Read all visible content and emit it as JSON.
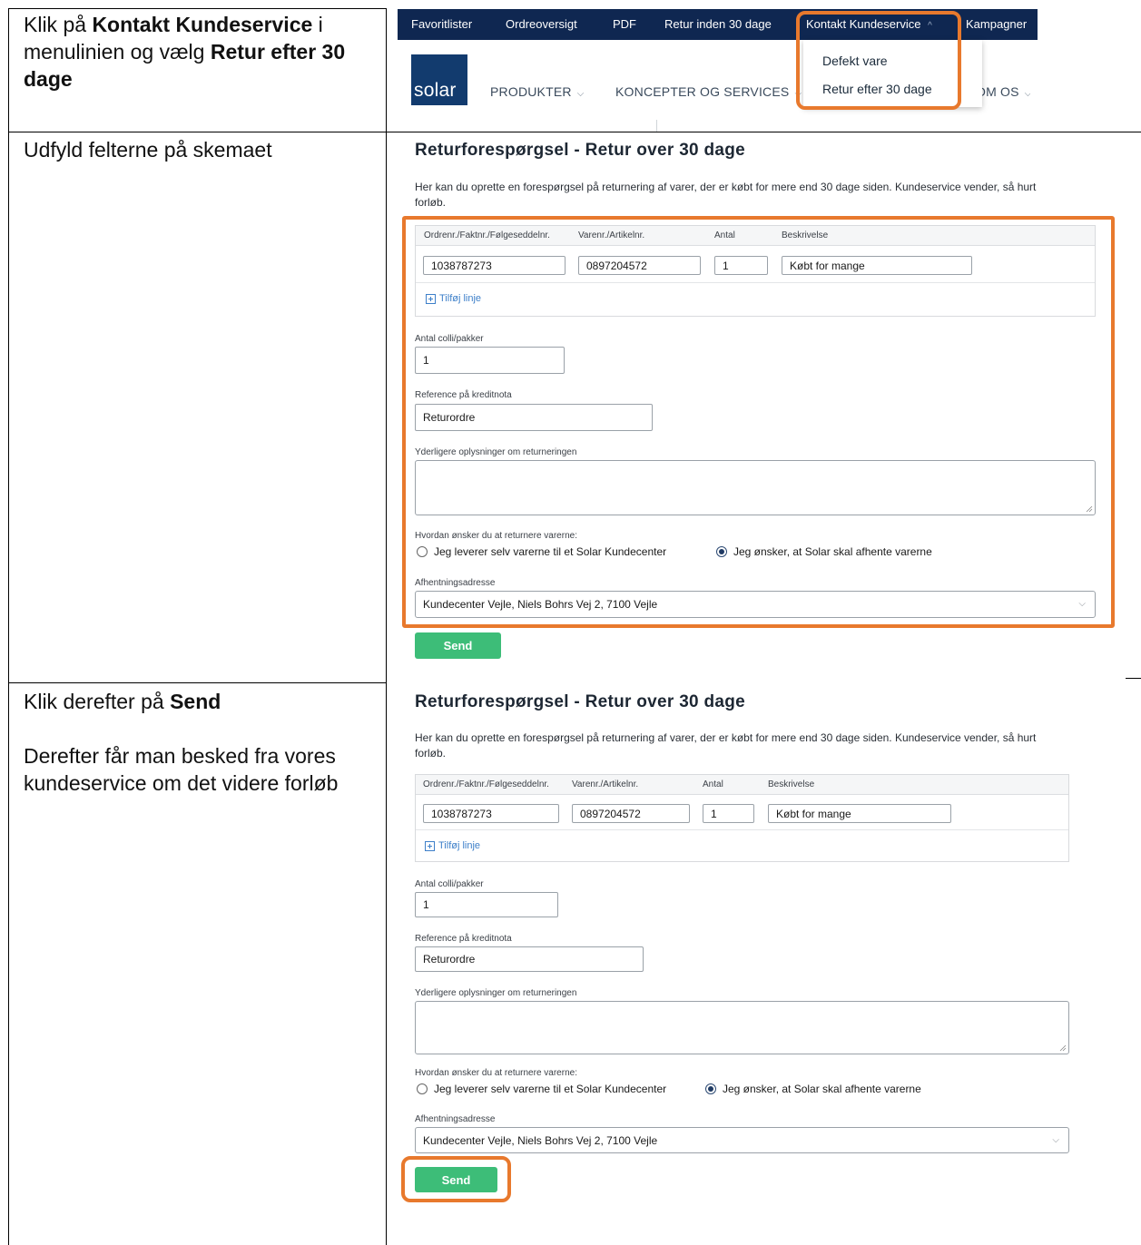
{
  "steps": [
    {
      "text_parts": [
        {
          "t": "Klik på ",
          "b": false
        },
        {
          "t": "Kontakt Kundeservice",
          "b": true
        },
        {
          "t": " i menulinien og vælg ",
          "b": false
        },
        {
          "t": "Retur efter 30 dage",
          "b": true
        }
      ]
    },
    {
      "text": "Udfyld felterne på skemaet"
    },
    {
      "text_parts": [
        {
          "t": "Klik derefter på ",
          "b": false
        },
        {
          "t": "Send",
          "b": true
        }
      ],
      "note": "Derefter får man besked fra vores kundeservice om det videre forløb"
    }
  ],
  "nav": {
    "top_items": [
      "Favoritlister",
      "Ordreoversigt",
      "PDF",
      "Retur inden 30 dage",
      "Kontakt Kundeservice",
      "Kampagner"
    ],
    "active_chevron": "^",
    "logo_text": "solar",
    "secondary_items": [
      "PRODUKTER",
      "KONCEPTER OG SERVICES",
      "OM OS"
    ],
    "dropdown_items": [
      "Defekt vare",
      "Retur efter 30 dage"
    ]
  },
  "form": {
    "title": "Returforespørgsel - Retur over 30 dage",
    "intro_line1": "Her kan du oprette en forespørgsel på returnering af varer, der er købt for mere end 30 dage siden. Kundeservice vender, så hurt",
    "intro_line2": "forløb.",
    "columns": [
      "Ordrenr./Faktnr./Følgeseddelnr.",
      "Varenr./Artikelnr.",
      "Antal",
      "Beskrivelse"
    ],
    "row": {
      "order": "1038787273",
      "item": "0897204572",
      "qty": "1",
      "desc": "Købt for mange"
    },
    "add_line": "Tilføj linje",
    "colli_label": "Antal colli/pakker",
    "colli_value": "1",
    "ref_label": "Reference på kreditnota",
    "ref_value": "Returordre",
    "info_label": "Yderligere oplysninger om returneringen",
    "return_question": "Hvordan ønsker du at returnere varerne:",
    "option_self": "Jeg leverer selv varerne til et Solar Kundecenter",
    "option_pickup": "Jeg ønsker, at Solar skal afhente varerne",
    "selected_option": "pickup",
    "address_label": "Afhentningsadresse",
    "address_value": "Kundecenter Vejle, Niels Bohrs Vej 2, 7100 Vejle",
    "send": "Send"
  },
  "colors": {
    "highlight": "#e8792d",
    "nav_bg": "#0f2751",
    "send_bg": "#3dbd78",
    "link": "#3d7fc9"
  }
}
